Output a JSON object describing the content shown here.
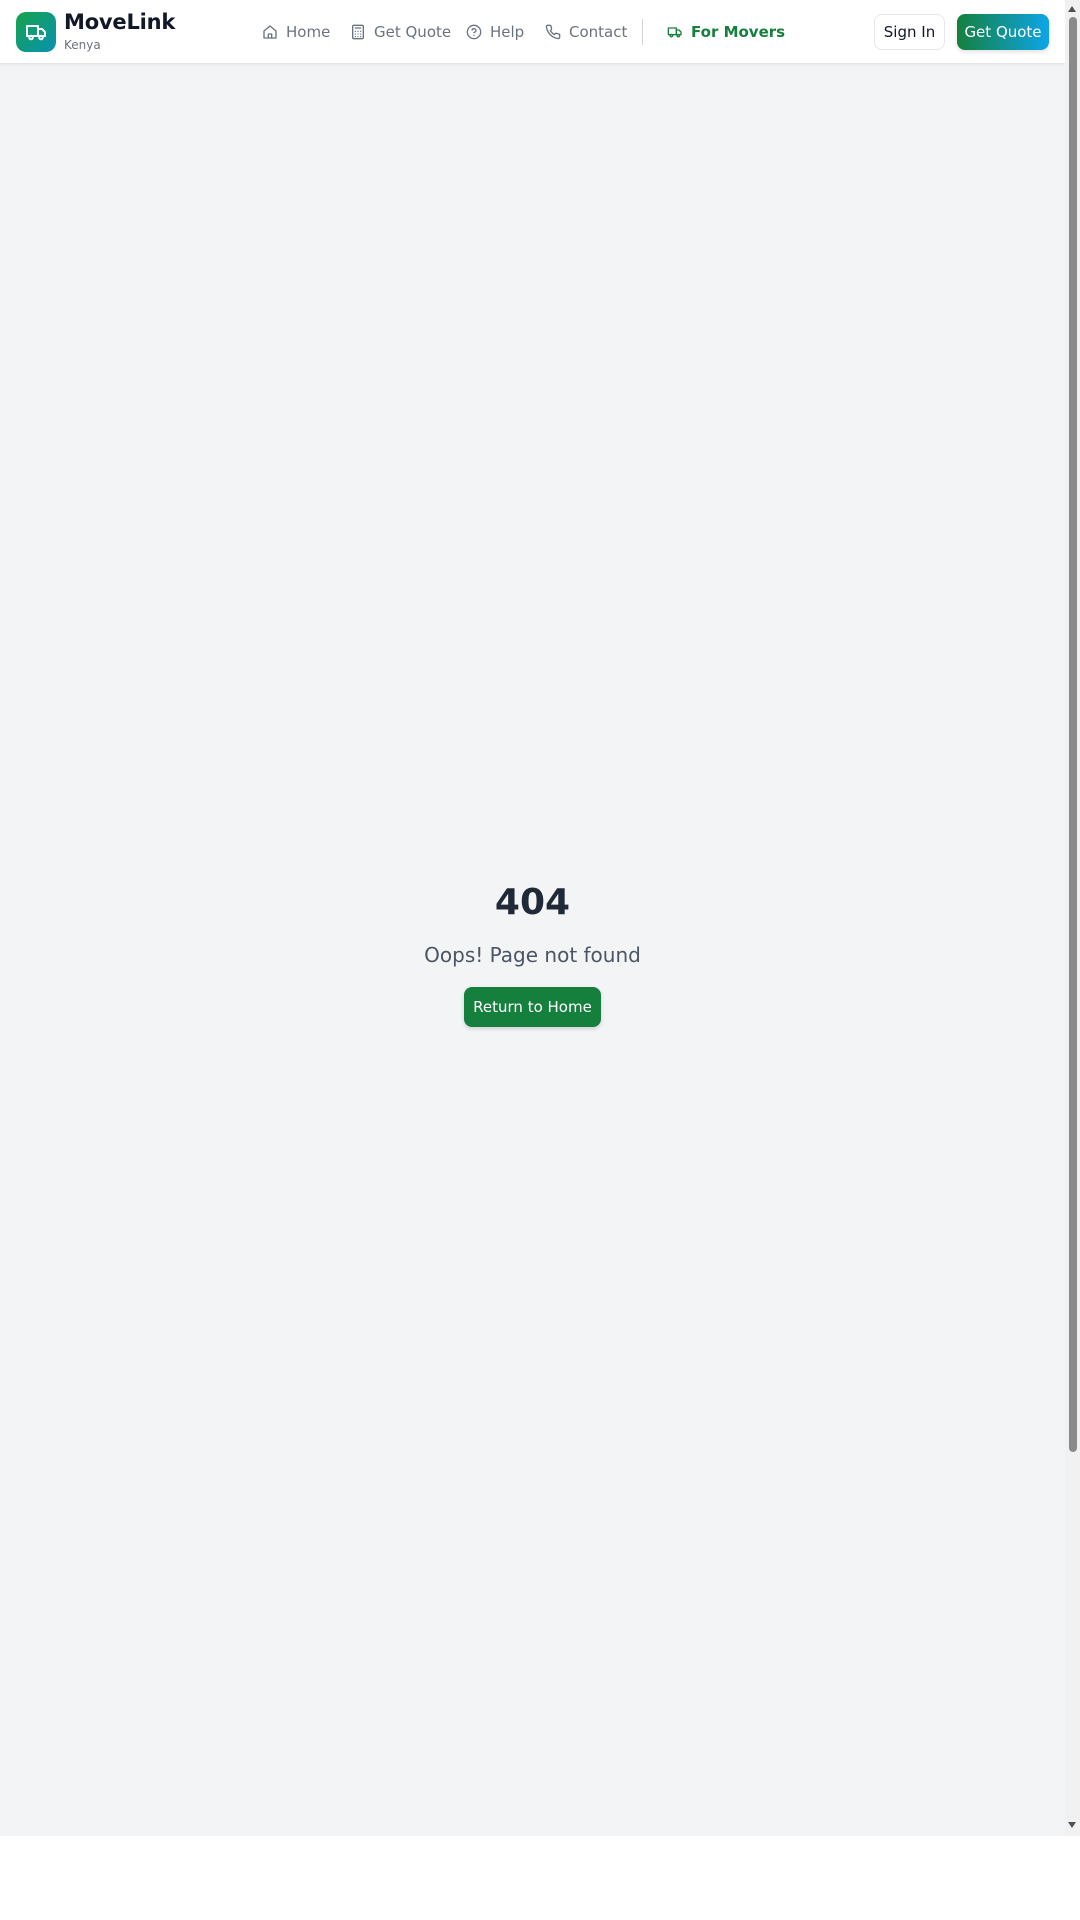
{
  "header": {
    "brand": {
      "name": "MoveLink",
      "subtitle": "Kenya"
    },
    "nav": [
      {
        "label": "Home",
        "icon": "home-icon"
      },
      {
        "label": "Get Quote",
        "icon": "calculator-icon"
      },
      {
        "label": "Help",
        "icon": "help-circle-icon"
      },
      {
        "label": "Contact",
        "icon": "phone-icon"
      },
      {
        "label": "For Movers",
        "icon": "truck-icon"
      }
    ],
    "actions": {
      "sign_in": "Sign In",
      "get_quote": "Get Quote"
    }
  },
  "not_found": {
    "code": "404",
    "message": "Oops! Page not found",
    "home_button": "Return to Home"
  },
  "colors": {
    "brand_green": "#15803d",
    "accent_cyan": "#0ea5e9",
    "page_background": "#f3f4f6",
    "nav_text": "#6b7280"
  }
}
